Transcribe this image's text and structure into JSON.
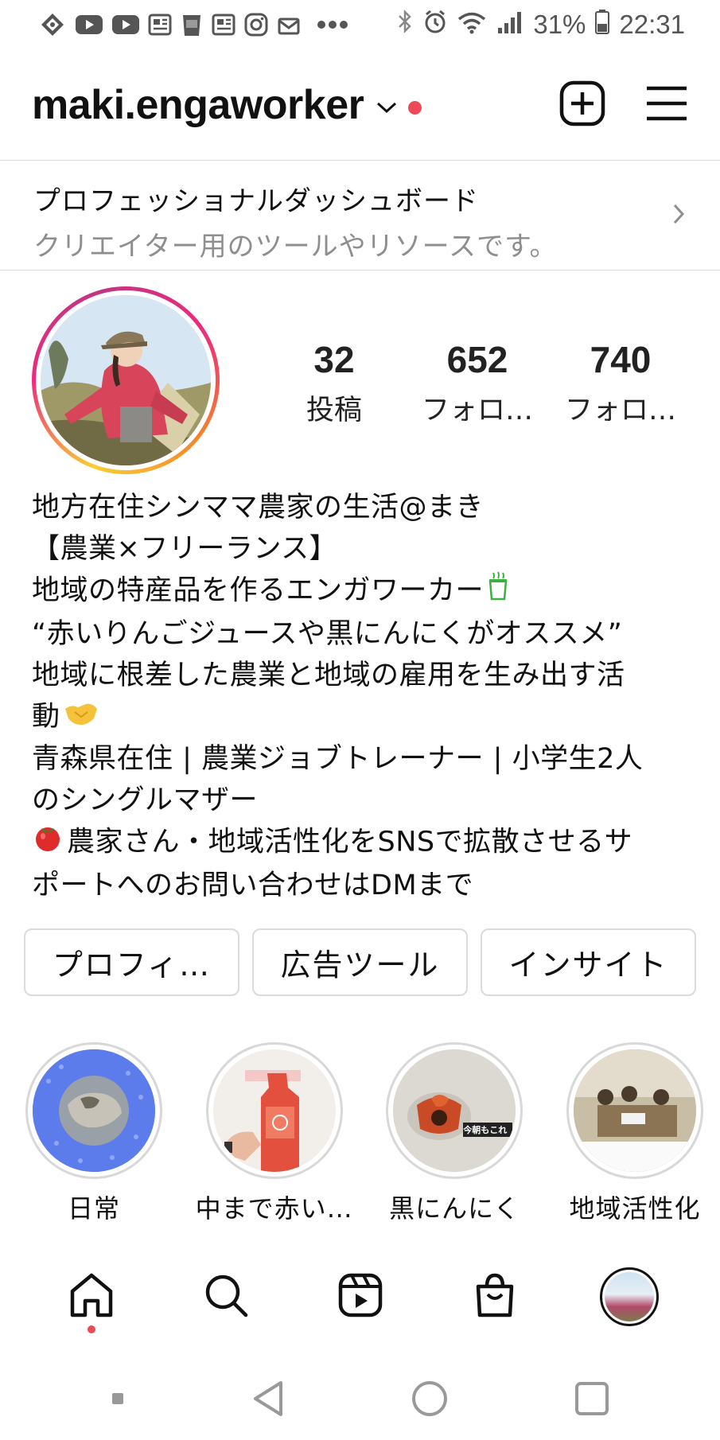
{
  "status_bar": {
    "battery": "31%",
    "time": "22:31",
    "left_icons": [
      "share-icon",
      "youtube-icon",
      "youtube-icon",
      "news-icon",
      "app-badge-icon",
      "news-icon",
      "instagram-icon",
      "mail-icon",
      "more-icon"
    ],
    "right_icons": [
      "bluetooth-icon",
      "alarm-icon",
      "wifi-icon",
      "signal-icon",
      "battery-icon"
    ]
  },
  "header": {
    "username": "maki.engaworker"
  },
  "dashboard": {
    "title": "プロフェッショナルダッシュボード",
    "subtitle": "クリエイター用のツールやリソースです。"
  },
  "stats": [
    {
      "value": "32",
      "label": "投稿"
    },
    {
      "value": "652",
      "label": "フォロ…"
    },
    {
      "value": "740",
      "label": "フォロ…"
    }
  ],
  "bio": {
    "line1": "地方在住シンママ農家の生活@まき",
    "line2": "【農業×フリーランス】",
    "line3": "地域の特産品を作るエンガワーカー",
    "line4": "“赤いりんごジュースや黒にんにくがオススメ”",
    "line5": "地域に根差した農業と地域の雇用を生み出す活",
    "line6": "動",
    "line7": "青森県在住 | 農業ジョブトレーナー | 小学生2人",
    "line8": "のシングルマザー",
    "line9": "農家さん・地域活性化をSNSで拡散させるサ",
    "line10": "ポートへのお問い合わせはDMまで"
  },
  "buttons": {
    "profile": "プロフィ…",
    "ad_tools": "広告ツール",
    "insights": "インサイト"
  },
  "highlights": [
    {
      "label": "日常"
    },
    {
      "label": "中まで赤い…"
    },
    {
      "label": "黒にんにく",
      "overlay": "今朝もこれ"
    },
    {
      "label": "地域活性化"
    }
  ],
  "colors": {
    "accent_red": "#ed4956",
    "divider": "#dbdbdb",
    "secondary_text": "#8e8e8e"
  }
}
